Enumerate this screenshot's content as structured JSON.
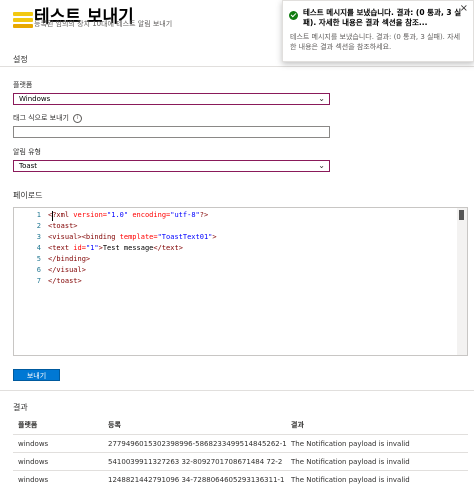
{
  "header": {
    "title": "테스트 보내기",
    "subtitle": "등록된 임의의 장치 10대에 테스트 알림 보내기"
  },
  "settings": {
    "section_label": "설정",
    "platform": {
      "label": "플랫폼",
      "value": "Windows"
    },
    "tag_expr": {
      "label": "태그 식으로 보내기",
      "value": ""
    },
    "notification_type": {
      "label": "알림 유형",
      "value": "Toast"
    }
  },
  "payload": {
    "label": "페이로드",
    "line_numbers": [
      "1",
      "2",
      "3",
      "4",
      "5",
      "6",
      "7"
    ],
    "lines": [
      {
        "a": "<?xml ",
        "b": "version=",
        "c": "\"1.0\" ",
        "d": "encoding=",
        "e": "\"utf-8\"",
        "f": "?>"
      },
      {
        "text": "<toast>"
      },
      {
        "a": "<visual><binding ",
        "b": "template=",
        "c": "\"ToastText01\"",
        "f": ">"
      },
      {
        "a": "<text ",
        "b": "id=",
        "c": "\"1\"",
        "f": ">",
        "t": "Test message",
        "g": "</text>"
      },
      {
        "text": "</binding>"
      },
      {
        "text": "</visual>"
      },
      {
        "text": "</toast>"
      }
    ]
  },
  "send_button": "보내기",
  "results": {
    "label": "결과",
    "headers": [
      "플랫폼",
      "등록",
      "결과"
    ],
    "rows": [
      [
        "windows",
        "2779496015302398996-5868233499514845262-1",
        "The Notification payload is invalid"
      ],
      [
        "windows",
        "5410039911327263 32-8092701708671484 72-2",
        "The Notification payload is invalid"
      ],
      [
        "windows",
        "1248821442791096 34-7288064605293136311-1",
        "The Notification payload is invalid"
      ]
    ]
  },
  "toast": {
    "title": "테스트 메시지를 보냈습니다. 결과: (0 통과, 3 실패). 자세한 내용은 결과 섹션을 참조...",
    "body": "테스트 메시지를 보냈습니다. 결과: (0 통과, 3 실패). 자세한 내용은 결과 섹션을 참조하세요.",
    "close": "×"
  },
  "colors": {
    "accent": "#0078d4",
    "select_border": "#8a1a5a",
    "success": "#107c10",
    "header_icon": "#f2c811"
  }
}
